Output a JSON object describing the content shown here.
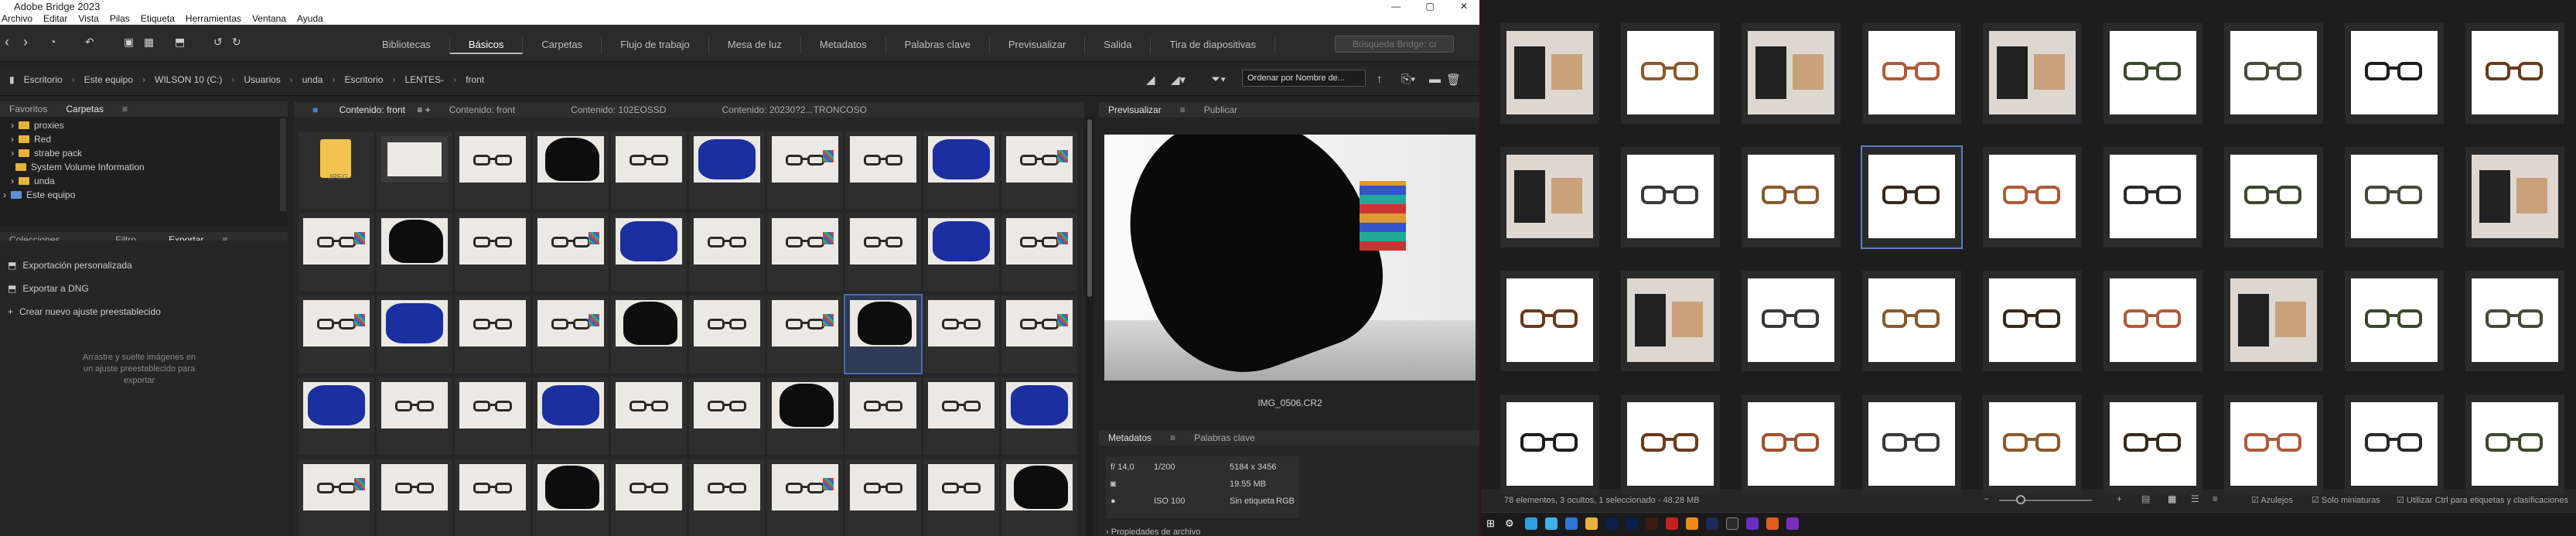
{
  "app": {
    "title": "Adobe Bridge 2023",
    "window_controls": [
      "—",
      "▢",
      "✕"
    ]
  },
  "menu": [
    "Archivo",
    "Editar",
    "Vista",
    "Pilas",
    "Etiqueta",
    "Herramientas",
    "Ventana",
    "Ayuda"
  ],
  "workspaces": [
    "Bibliotecas",
    "Básicos",
    "Carpetas",
    "Flujo de trabajo",
    "Mesa de luz",
    "Metadatos",
    "Palabras clave",
    "Previsualizar",
    "Salida",
    "Tira de diapositivas"
  ],
  "active_workspace": "Básicos",
  "search": {
    "placeholder": "Búsqueda Bridge: carp"
  },
  "breadcrumb": [
    "Escritorio",
    "Este equipo",
    "WILSON 10 (C:)",
    "Usuarios",
    "unda",
    "Escritorio",
    "LENTES-",
    "front"
  ],
  "sort": {
    "value": "Ordenar por Nombre de..."
  },
  "panels": {
    "top_left_tabs": [
      "Favoritos",
      "Carpetas"
    ],
    "folders": [
      "proxies",
      "Red",
      "strabe pack",
      "System Volume Information",
      "unda",
      "Este equipo"
    ],
    "bottom_left_tabs": [
      "Colecciones",
      "Filtro",
      "Exportar"
    ],
    "export_items": [
      "Exportación personalizada",
      "Exportar a DNG",
      "Crear nuevo ajuste preestablecido"
    ],
    "drop_hint": "Arrastre y suelte imágenes en un ajuste preestablecido para exportar"
  },
  "content_tabs": [
    "Contenido: front",
    "Contenido: front",
    "Contenido: 102EOSSD",
    "Contenido: 20230?2...TRONCOSO"
  ],
  "folder_thumb_label": "JPEG",
  "preview": {
    "tabs": [
      "Previsualizar",
      "Publicar"
    ],
    "filename": "IMG_0506.CR2"
  },
  "metadata": {
    "tabs": [
      "Metadatos",
      "Palabras clave"
    ],
    "aperture": "f/ 14,0",
    "shutter": "1/200",
    "dims": "5184 x 3456",
    "size": "19.55 MB",
    "iso": "ISO 100",
    "label": "Sin etiqueta",
    "mode": "RGB",
    "section": "Propiedades de archivo"
  },
  "status": {
    "text": "78 elementos, 3 ocultos, 1 seleccionado - 48.28 MB",
    "options": [
      "Azulejos",
      "Solo miniaturas",
      "Utilizar Ctrl para etiquetas y clasificaciones"
    ]
  }
}
